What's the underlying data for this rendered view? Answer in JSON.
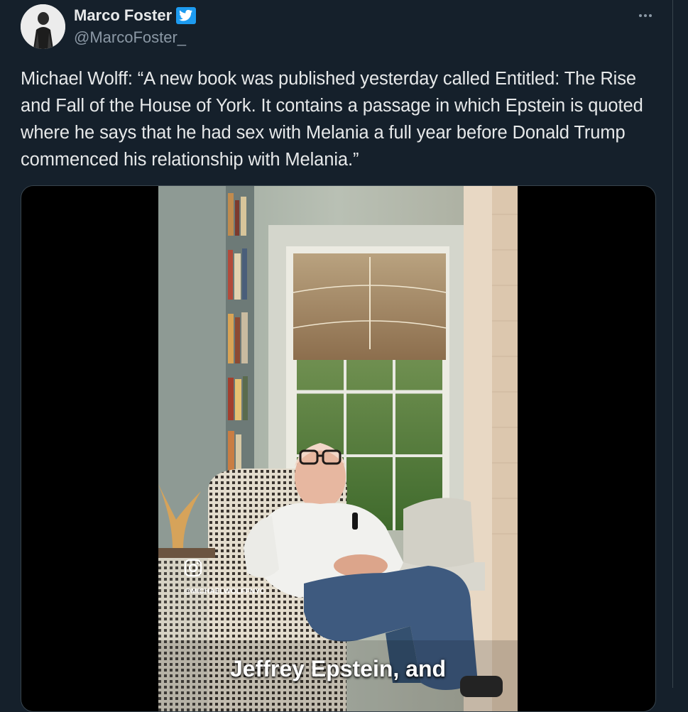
{
  "author": {
    "display_name": "Marco Foster",
    "handle": "@MarcoFoster_",
    "verified": true,
    "avatar_icon": "person-portrait-icon"
  },
  "tweet": {
    "text": "Michael Wolff: “A new book was published yesterday called Entitled: The Rise and Fall of the House of York. It contains a passage in which Epstein is quoted where he says that he had sex with Melania a full year before Donald Trump commenced his relationship with Melania.”"
  },
  "media": {
    "type": "video",
    "watermark_handle": "@MICHAELWOLFFNYC",
    "watermark_icon": "instagram-icon",
    "caption": "Jeffrey Epstein, and"
  },
  "colors": {
    "background": "#15202b",
    "text_primary": "#e7e9ea",
    "text_secondary": "#8b98a5",
    "verified_blue": "#1d9bf0",
    "border": "#38444d"
  }
}
